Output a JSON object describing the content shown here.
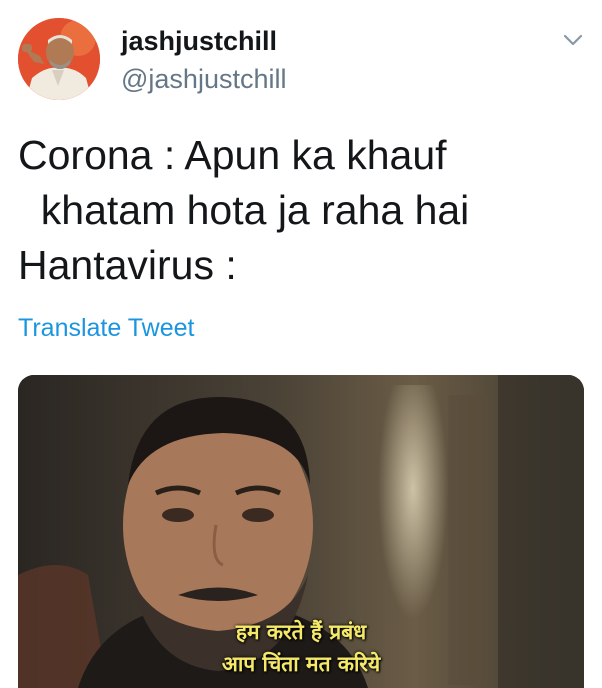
{
  "user": {
    "display_name": "jashjustchill",
    "handle": "@jashjustchill"
  },
  "icons": {
    "more": "chevron-down-icon",
    "avatar": "avatar"
  },
  "tweet": {
    "lines": [
      "Corona : Apun ka khauf",
      "  khatam hota ja raha hai",
      "Hantavirus :"
    ],
    "translate_label": "Translate Tweet"
  },
  "media": {
    "subtitle_line1": "हम करते हैं प्रबंध",
    "subtitle_line2": "आप चिंता मत करिये"
  },
  "colors": {
    "link": "#1b95e0",
    "handle": "#657786",
    "text": "#14171a",
    "subtitle": "#f5e96a",
    "avatar_bg": "#e74a2a"
  }
}
